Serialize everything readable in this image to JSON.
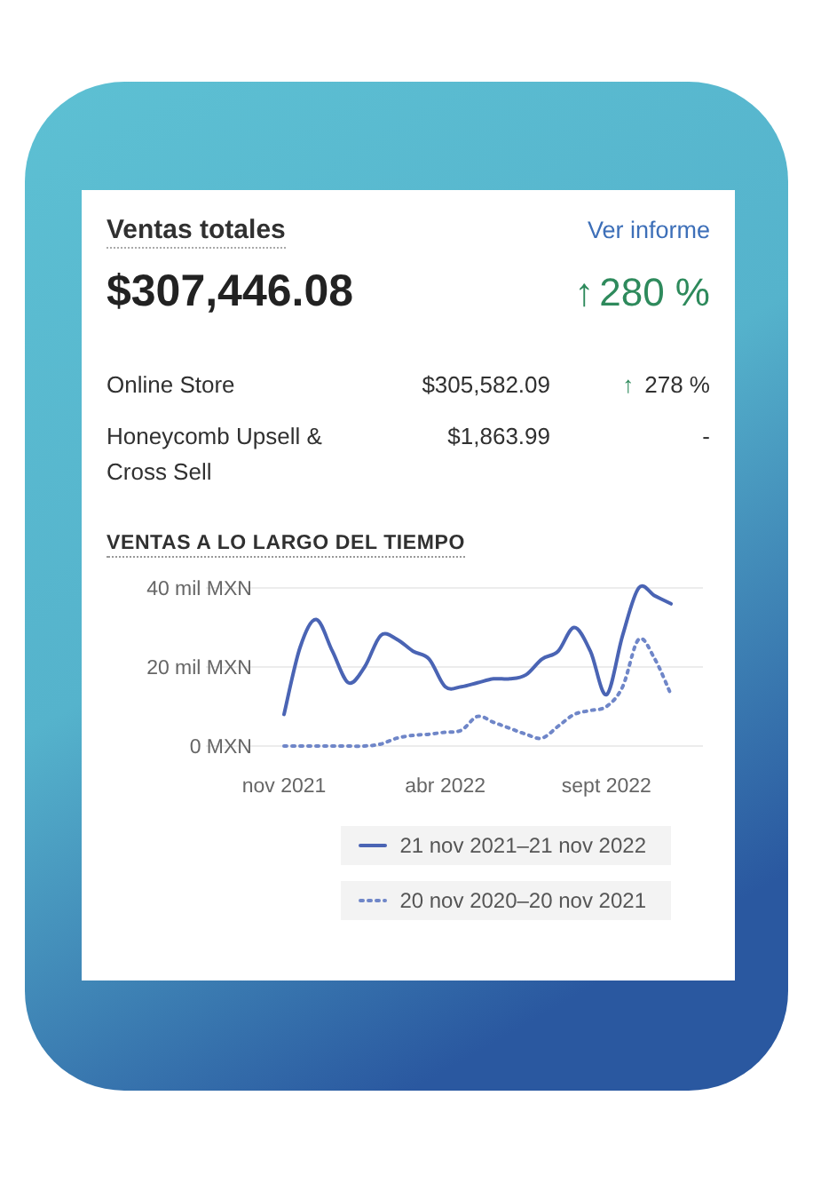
{
  "card": {
    "title": "Ventas totales",
    "link": "Ver informe",
    "total": "$307,446.08",
    "arrow": "↑",
    "change": "280 %"
  },
  "rows": [
    {
      "name": "Online Store",
      "amount": "$305,582.09",
      "arrow": "↑",
      "change": "278 %"
    },
    {
      "name": "Honeycomb Upsell & Cross Sell",
      "amount": "$1,863.99",
      "change": "-"
    }
  ],
  "chart_section": {
    "title": "VENTAS A LO LARGO DEL TIEMPO",
    "chart_data": {
      "type": "line",
      "categories": [
        "nov 2021",
        null,
        null,
        null,
        null,
        null,
        null,
        null,
        null,
        null,
        "abr 2022",
        null,
        null,
        null,
        null,
        null,
        null,
        null,
        null,
        null,
        "sept 2022",
        null,
        null,
        null,
        null
      ],
      "series": [
        {
          "name": "21 nov 2021–21 nov 2022",
          "color": "#4a64b4",
          "line_style": "solid",
          "values": [
            8,
            25,
            32,
            24,
            16,
            20,
            28,
            27,
            24,
            22,
            15,
            15,
            16,
            17,
            17,
            18,
            22,
            24,
            30,
            24,
            13,
            28,
            40,
            38,
            36
          ]
        },
        {
          "name": "20 nov 2020–20 nov 2021",
          "color": "#6f86c8",
          "line_style": "dotted",
          "values": [
            0,
            0,
            0,
            0,
            0,
            0,
            0.5,
            2,
            2.7,
            3,
            3.5,
            4,
            7.5,
            6,
            4.5,
            3,
            2,
            5,
            8,
            9,
            10,
            15,
            27,
            22,
            13
          ]
        }
      ],
      "ylim": [
        0,
        40
      ],
      "yticks": [
        {
          "value": 0,
          "label": "0 MXN"
        },
        {
          "value": 20,
          "label": "20 mil MXN"
        },
        {
          "value": 40,
          "label": "40 mil MXN"
        }
      ]
    }
  }
}
